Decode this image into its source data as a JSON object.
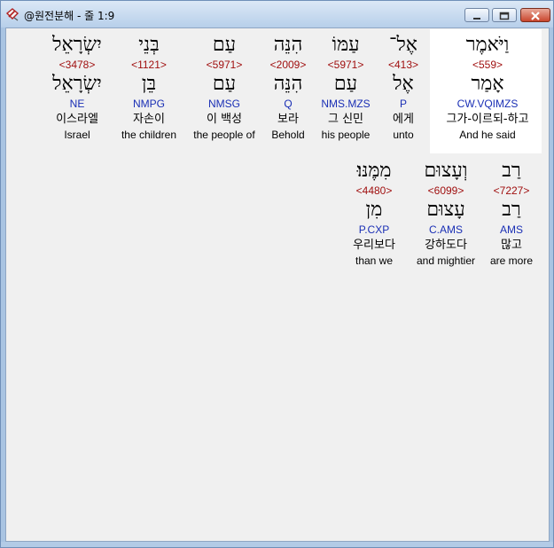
{
  "window": {
    "title": "@원전분해 - 줄 1:9",
    "app_icon": "book-pencil-icon",
    "minimize_icon": "minimize-icon",
    "maximize_icon": "maximize-icon",
    "close_icon": "close-icon",
    "close_color": "#c9452d"
  },
  "line1": [
    {
      "heb": "וַיֹּאמֶר",
      "strong": "<559>",
      "root": "אָמַר",
      "parse": "CW.VQIMZS",
      "kor": "그가-이르되-하고",
      "eng": "And he said",
      "selected": true
    },
    {
      "heb": "אֶל־",
      "strong": "<413>",
      "root": "אֶל",
      "parse": "P",
      "kor": "에게",
      "eng": "unto"
    },
    {
      "heb": "עַמּוֹ",
      "strong": "<5971>",
      "root": "עַם",
      "parse": "NMS.MZS",
      "kor": "그 신민",
      "eng": "his people"
    },
    {
      "heb": "הִנֵּה",
      "strong": "<2009>",
      "root": "הִנֵּה",
      "parse": "Q",
      "kor": "보라",
      "eng": "Behold"
    },
    {
      "heb": "עַם",
      "strong": "<5971>",
      "root": "עַם",
      "parse": "NMSG",
      "kor": "이 백성",
      "eng": "the people of"
    },
    {
      "heb": "בְּנֵי",
      "strong": "<1121>",
      "root": "בֵּן",
      "parse": "NMPG",
      "kor": "자손이",
      "eng": "the children"
    },
    {
      "heb": "יִשְׂרָאֵל",
      "strong": "<3478>",
      "root": "יִשְׂרָאֵל",
      "parse": "NE",
      "kor": "이스라엘",
      "eng": "Israel"
    }
  ],
  "line2": [
    {
      "heb": "רַב",
      "strong": "<7227>",
      "root": "רַב",
      "parse": "AMS",
      "kor": "많고",
      "eng": "are more"
    },
    {
      "heb": "וְעָצוּם",
      "strong": "<6099>",
      "root": "עָצוּם",
      "parse": "C.AMS",
      "kor": "강하도다",
      "eng": "and mightier"
    },
    {
      "heb": "מִמֶּנּוּ׃",
      "strong": "<4480>",
      "root": "מִן",
      "parse": "P.CXP",
      "kor": "우리보다",
      "eng": "than we"
    }
  ],
  "colors": {
    "strong_number": "#a01010",
    "parsing_code": "#1a2fb5",
    "selection_background": "#ffffff",
    "title_bar": "#b7cfea"
  }
}
